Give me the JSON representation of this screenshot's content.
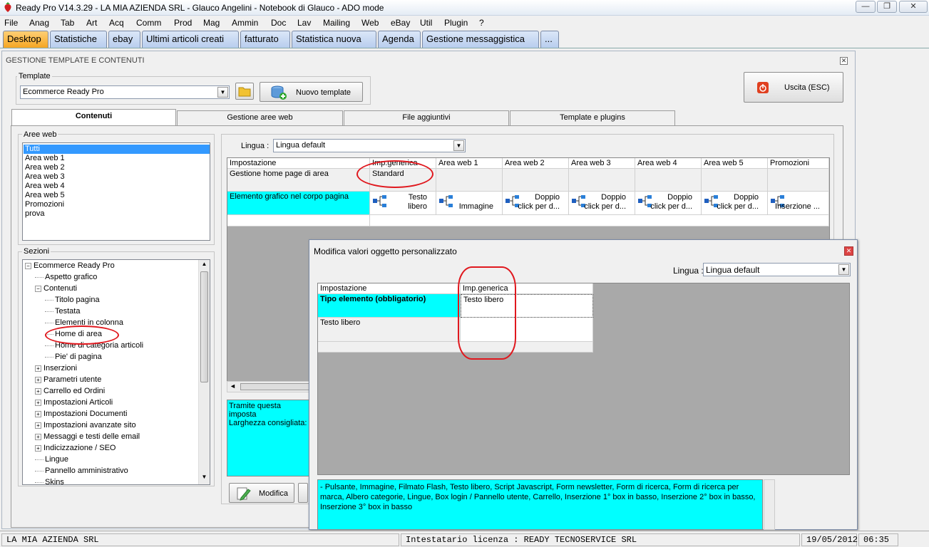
{
  "window": {
    "title": "Ready Pro V14.3.29 - LA MIA AZIENDA SRL - Glauco Angelini - Notebook di Glauco - ADO mode",
    "minimize": "—",
    "restore": "❐",
    "close": "✕"
  },
  "menu": [
    "File",
    "Anag",
    "Tab",
    "Art",
    "Acq",
    "Comm",
    "Prod",
    "Mag",
    "Ammin",
    "Doc",
    "Lav",
    "Mailing",
    "Web",
    "eBay",
    "Util",
    "Plugin",
    "?"
  ],
  "top_tabs": [
    "Desktop",
    "Statistiche",
    "ebay",
    "Ultimi articoli creati",
    "fatturato",
    "Statistica nuova",
    "Agenda",
    "Gestione messaggistica",
    "..."
  ],
  "main": {
    "title": "GESTIONE TEMPLATE E CONTENUTI",
    "template_label": "Template",
    "template_value": "Ecommerce Ready Pro",
    "new_template_label": "Nuovo template",
    "exit_label": "Uscita (ESC)",
    "content_tabs": [
      "Contenuti",
      "Gestione aree web",
      "File aggiuntivi",
      "Template e plugins"
    ],
    "aree_web_label": "Aree web",
    "aree_web": [
      "Tutti",
      "Area web 1",
      "Area web 2",
      "Area web 3",
      "Area web 4",
      "Area web 5",
      "Promozioni",
      "prova"
    ],
    "sezioni_label": "Sezioni",
    "tree": [
      {
        "label": "Ecommerce Ready Pro",
        "level": 0,
        "expander": "−"
      },
      {
        "label": "Aspetto grafico",
        "level": 1,
        "expander": ""
      },
      {
        "label": "Contenuti",
        "level": 1,
        "expander": "−"
      },
      {
        "label": "Titolo pagina",
        "level": 2,
        "expander": ""
      },
      {
        "label": "Testata",
        "level": 2,
        "expander": ""
      },
      {
        "label": "Elementi in colonna",
        "level": 2,
        "expander": ""
      },
      {
        "label": "Home di area",
        "level": 2,
        "expander": ""
      },
      {
        "label": "Home di categoria articoli",
        "level": 2,
        "expander": ""
      },
      {
        "label": "Pie' di pagina",
        "level": 2,
        "expander": ""
      },
      {
        "label": "Inserzioni",
        "level": 1,
        "expander": "+"
      },
      {
        "label": "Parametri utente",
        "level": 1,
        "expander": "+"
      },
      {
        "label": "Carrello ed Ordini",
        "level": 1,
        "expander": "+"
      },
      {
        "label": "Impostazioni Articoli",
        "level": 1,
        "expander": "+"
      },
      {
        "label": "Impostazioni Documenti",
        "level": 1,
        "expander": "+"
      },
      {
        "label": "Impostazioni avanzate sito",
        "level": 1,
        "expander": "+"
      },
      {
        "label": "Messaggi e testi delle email",
        "level": 1,
        "expander": "+"
      },
      {
        "label": "Indicizzazione / SEO",
        "level": 1,
        "expander": "+"
      },
      {
        "label": "Lingue",
        "level": 1,
        "expander": ""
      },
      {
        "label": "Pannello amministrativo",
        "level": 1,
        "expander": ""
      },
      {
        "label": "Skins",
        "level": 1,
        "expander": ""
      }
    ],
    "lingua_label": "Lingua :",
    "lingua_value": "Lingua default",
    "grid_headers": [
      "Impostazione",
      "Imp.generica",
      "Area web 1",
      "Area web 2",
      "Area web 3",
      "Area web 4",
      "Area web 5",
      "Promozioni"
    ],
    "grid_row1": [
      "Gestione home page di area",
      "Standard",
      "",
      "",
      "",
      "",
      "",
      ""
    ],
    "grid_row2_label": "Elemento grafico nel corpo pagina",
    "grid_row2": [
      {
        "l1": "Testo",
        "l2": "libero"
      },
      {
        "l1": "",
        "l2": "Immagine"
      },
      {
        "l1": "Doppio",
        "l2": "click per d..."
      },
      {
        "l1": "Doppio",
        "l2": "click per d..."
      },
      {
        "l1": "Doppio",
        "l2": "click per d..."
      },
      {
        "l1": "Doppio",
        "l2": "click per d..."
      },
      {
        "l1": "",
        "l2": "Inserzione ..."
      }
    ],
    "desc_line1": "Tramite questa imposta",
    "desc_line2": "Larghezza consigliata:",
    "modifica_label": "Modifica"
  },
  "dialog": {
    "title": "Modifica valori oggetto personalizzato",
    "lingua_label": "Lingua :",
    "lingua_value": "Lingua default",
    "headers": [
      "Impostazione",
      "Imp.generica"
    ],
    "row1_label": "Tipo elemento (obbligatorio)",
    "row1_value": "Testo libero",
    "row2_label": "Testo libero",
    "row2_value": "",
    "description": "- Pulsante, Immagine, Filmato Flash, Testo libero, Script Javascript, Form newsletter, Form di ricerca, Form di ricerca per marca, Albero categorie, Lingue, Box login / Pannello utente, Carrello, Inserzione 1° box in basso, Inserzione 2° box in basso, Inserzione 3° box in basso"
  },
  "status": {
    "company": "LA MIA AZIENDA SRL",
    "license": "Intestatario licenza : READY TECNOSERVICE SRL",
    "date": "19/05/2012",
    "time": "06:35"
  },
  "colors": {
    "highlight": "#00ffff",
    "active_tab": "#f5a623",
    "selection": "#3399ff",
    "annotation": "#e0181e"
  }
}
